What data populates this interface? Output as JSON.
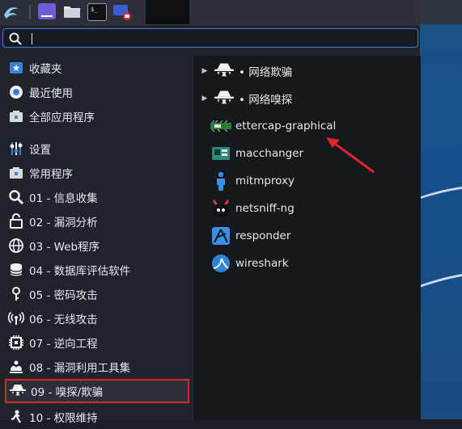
{
  "taskbar": {
    "launcher_icon": "kali-dragon-icon",
    "apps": [
      {
        "icon": "workspace-icon",
        "color": "#6c5ed6"
      },
      {
        "icon": "folder-icon",
        "color": "#e8e8e8"
      },
      {
        "icon": "terminal-icon",
        "color": "#111111"
      },
      {
        "icon": "screen-record-icon",
        "color": "#3c5cd0"
      }
    ]
  },
  "search": {
    "value": "",
    "placeholder": ""
  },
  "categories": [
    {
      "label": "收藏夹",
      "icon": "favorites-icon"
    },
    {
      "label": "最近使用",
      "icon": "recent-icon"
    },
    {
      "label": "全部应用程序",
      "icon": "all-apps-icon"
    },
    {
      "label": "设置",
      "icon": "settings-icon"
    },
    {
      "label": "常用程序",
      "icon": "usual-apps-icon"
    },
    {
      "label": "01 - 信息收集",
      "icon": "magnifier-icon"
    },
    {
      "label": "02 - 漏洞分析",
      "icon": "vuln-analysis-icon"
    },
    {
      "label": "03 - Web程序",
      "icon": "globe-icon"
    },
    {
      "label": "04 - 数据库评估软件",
      "icon": "database-icon"
    },
    {
      "label": "05 - 密码攻击",
      "icon": "key-icon"
    },
    {
      "label": "06 - 无线攻击",
      "icon": "wireless-icon"
    },
    {
      "label": "07 - 逆向工程",
      "icon": "chip-icon"
    },
    {
      "label": "08 - 漏洞利用工具集",
      "icon": "exploit-icon"
    },
    {
      "label": "09 - 嗅探/欺骗",
      "icon": "spy-icon",
      "selected": true
    },
    {
      "label": "10 - 权限维持",
      "icon": "persistence-icon"
    }
  ],
  "apps": [
    {
      "label": "• 网络欺骗",
      "icon": "spy-icon",
      "submenu": true
    },
    {
      "label": "• 网络嗅探",
      "icon": "spy-icon",
      "submenu": true
    },
    {
      "label": "ettercap-graphical",
      "icon": "ettercap-icon"
    },
    {
      "label": "macchanger",
      "icon": "macchanger-icon"
    },
    {
      "label": "mitmproxy",
      "icon": "mitmproxy-icon"
    },
    {
      "label": "netsniff-ng",
      "icon": "netsniff-icon"
    },
    {
      "label": "responder",
      "icon": "responder-icon"
    },
    {
      "label": "wireshark",
      "icon": "wireshark-icon"
    }
  ],
  "colors": {
    "selection_border": "#e0242b",
    "search_border": "#3a7fd5",
    "annotation_arrow": "#e0242b"
  }
}
